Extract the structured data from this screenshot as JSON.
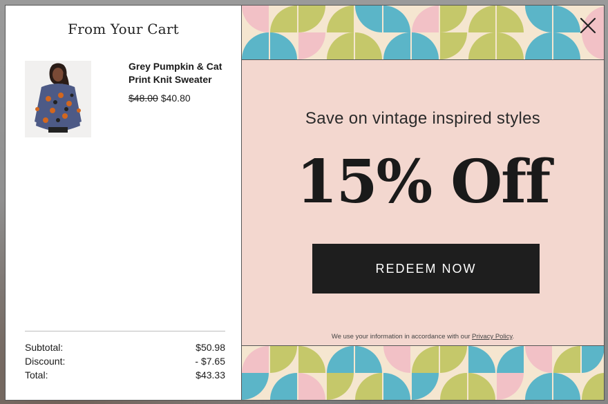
{
  "cart": {
    "title": "From Your Cart",
    "item": {
      "name": "Grey Pumpkin & Cat Print Knit Sweater",
      "price_original": "$48.00",
      "price_sale": "$40.80",
      "image_icon": "product-sweater-image"
    },
    "totals": [
      {
        "label": "Subtotal:",
        "value": "$50.98"
      },
      {
        "label": "Discount:",
        "value": "- $7.65"
      },
      {
        "label": "Total:",
        "value": "$43.33"
      }
    ]
  },
  "promo": {
    "headline": "Save on vintage inspired styles",
    "offer": "15% Off",
    "button_label": "REDEEM NOW",
    "disclaimer_prefix": "We use your information in accordance with our",
    "privacy_link": "Privacy Policy",
    "disclaimer_suffix": ".",
    "close_icon": "close-icon"
  },
  "colors": {
    "promo_background": "#f3d7cf",
    "button": "#1e1e1e",
    "pattern_blue": "#5bb5c8",
    "pattern_green": "#c5c86a",
    "pattern_pink": "#f2c1c6",
    "pattern_cream": "#f5e6d0"
  }
}
